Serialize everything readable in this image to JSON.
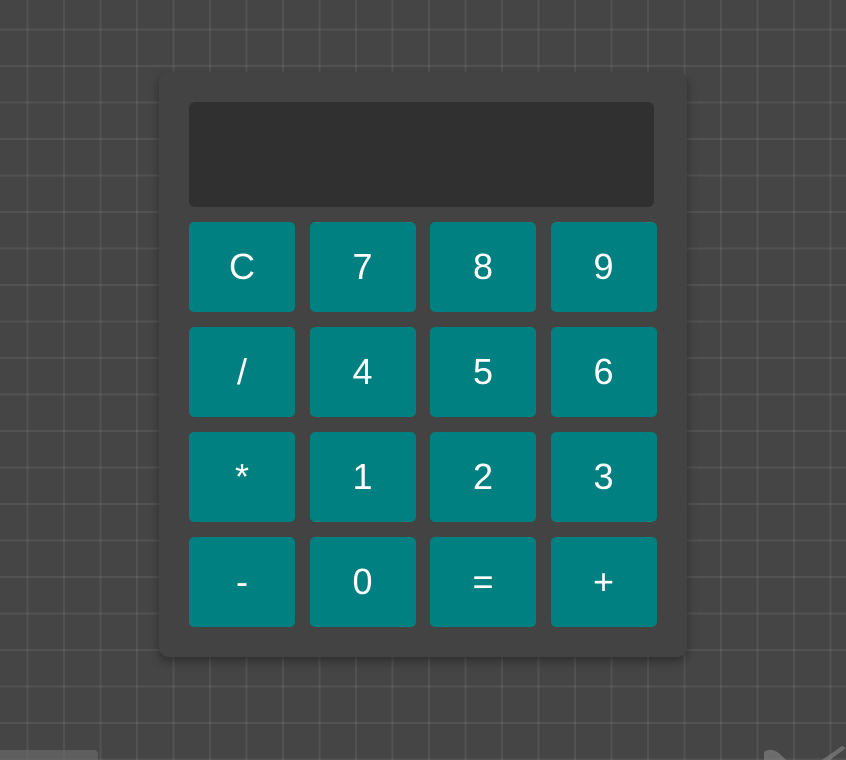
{
  "calculator": {
    "display": {
      "value": ""
    },
    "keys": [
      {
        "label": "C",
        "name": "clear-button"
      },
      {
        "label": "7",
        "name": "key-7-button"
      },
      {
        "label": "8",
        "name": "key-8-button"
      },
      {
        "label": "9",
        "name": "key-9-button"
      },
      {
        "label": "/",
        "name": "divide-button"
      },
      {
        "label": "4",
        "name": "key-4-button"
      },
      {
        "label": "5",
        "name": "key-5-button"
      },
      {
        "label": "6",
        "name": "key-6-button"
      },
      {
        "label": "*",
        "name": "multiply-button"
      },
      {
        "label": "1",
        "name": "key-1-button"
      },
      {
        "label": "2",
        "name": "key-2-button"
      },
      {
        "label": "3",
        "name": "key-3-button"
      },
      {
        "label": "-",
        "name": "subtract-button"
      },
      {
        "label": "0",
        "name": "key-0-button"
      },
      {
        "label": "=",
        "name": "equals-button"
      },
      {
        "label": "+",
        "name": "add-button"
      }
    ]
  },
  "colors": {
    "background": "#454545",
    "calculator_body": "#434343",
    "display": "#303030",
    "key": "#008080",
    "key_text": "#ffffff"
  }
}
